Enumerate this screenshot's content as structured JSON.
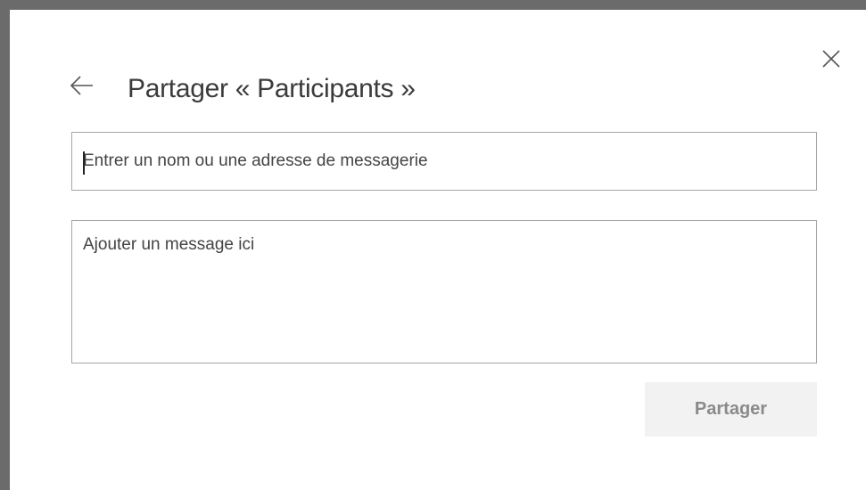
{
  "dialog": {
    "title": "Partager « Participants »",
    "back_icon": "arrow-left-icon",
    "close_icon": "close-icon",
    "recipient": {
      "value": "",
      "placeholder": "Entrer un nom ou une adresse de messagerie"
    },
    "message": {
      "value": "",
      "placeholder": "Ajouter un message ici"
    },
    "share_button_label": "Partager"
  },
  "colors": {
    "frame": "#6b6b6b",
    "text": "#3b3b3b",
    "field_border": "#a6a6a6",
    "button_bg": "#f2f2f2",
    "button_text": "#8a8a8a"
  }
}
